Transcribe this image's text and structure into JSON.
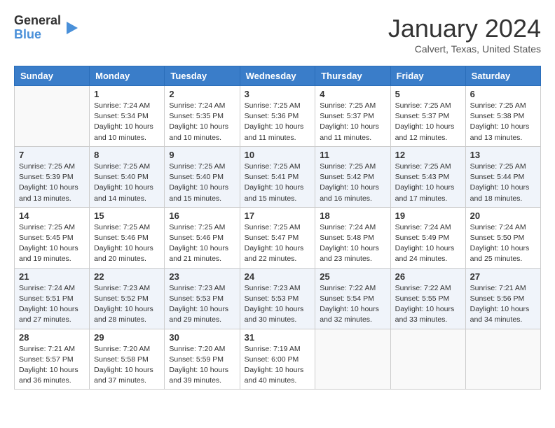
{
  "header": {
    "logo_general": "General",
    "logo_blue": "Blue",
    "month_title": "January 2024",
    "subtitle": "Calvert, Texas, United States"
  },
  "weekdays": [
    "Sunday",
    "Monday",
    "Tuesday",
    "Wednesday",
    "Thursday",
    "Friday",
    "Saturday"
  ],
  "weeks": [
    [
      {
        "day": "",
        "info": ""
      },
      {
        "day": "1",
        "info": "Sunrise: 7:24 AM\nSunset: 5:34 PM\nDaylight: 10 hours\nand 10 minutes."
      },
      {
        "day": "2",
        "info": "Sunrise: 7:24 AM\nSunset: 5:35 PM\nDaylight: 10 hours\nand 10 minutes."
      },
      {
        "day": "3",
        "info": "Sunrise: 7:25 AM\nSunset: 5:36 PM\nDaylight: 10 hours\nand 11 minutes."
      },
      {
        "day": "4",
        "info": "Sunrise: 7:25 AM\nSunset: 5:37 PM\nDaylight: 10 hours\nand 11 minutes."
      },
      {
        "day": "5",
        "info": "Sunrise: 7:25 AM\nSunset: 5:37 PM\nDaylight: 10 hours\nand 12 minutes."
      },
      {
        "day": "6",
        "info": "Sunrise: 7:25 AM\nSunset: 5:38 PM\nDaylight: 10 hours\nand 13 minutes."
      }
    ],
    [
      {
        "day": "7",
        "info": "Sunrise: 7:25 AM\nSunset: 5:39 PM\nDaylight: 10 hours\nand 13 minutes."
      },
      {
        "day": "8",
        "info": "Sunrise: 7:25 AM\nSunset: 5:40 PM\nDaylight: 10 hours\nand 14 minutes."
      },
      {
        "day": "9",
        "info": "Sunrise: 7:25 AM\nSunset: 5:40 PM\nDaylight: 10 hours\nand 15 minutes."
      },
      {
        "day": "10",
        "info": "Sunrise: 7:25 AM\nSunset: 5:41 PM\nDaylight: 10 hours\nand 15 minutes."
      },
      {
        "day": "11",
        "info": "Sunrise: 7:25 AM\nSunset: 5:42 PM\nDaylight: 10 hours\nand 16 minutes."
      },
      {
        "day": "12",
        "info": "Sunrise: 7:25 AM\nSunset: 5:43 PM\nDaylight: 10 hours\nand 17 minutes."
      },
      {
        "day": "13",
        "info": "Sunrise: 7:25 AM\nSunset: 5:44 PM\nDaylight: 10 hours\nand 18 minutes."
      }
    ],
    [
      {
        "day": "14",
        "info": "Sunrise: 7:25 AM\nSunset: 5:45 PM\nDaylight: 10 hours\nand 19 minutes."
      },
      {
        "day": "15",
        "info": "Sunrise: 7:25 AM\nSunset: 5:46 PM\nDaylight: 10 hours\nand 20 minutes."
      },
      {
        "day": "16",
        "info": "Sunrise: 7:25 AM\nSunset: 5:46 PM\nDaylight: 10 hours\nand 21 minutes."
      },
      {
        "day": "17",
        "info": "Sunrise: 7:25 AM\nSunset: 5:47 PM\nDaylight: 10 hours\nand 22 minutes."
      },
      {
        "day": "18",
        "info": "Sunrise: 7:24 AM\nSunset: 5:48 PM\nDaylight: 10 hours\nand 23 minutes."
      },
      {
        "day": "19",
        "info": "Sunrise: 7:24 AM\nSunset: 5:49 PM\nDaylight: 10 hours\nand 24 minutes."
      },
      {
        "day": "20",
        "info": "Sunrise: 7:24 AM\nSunset: 5:50 PM\nDaylight: 10 hours\nand 25 minutes."
      }
    ],
    [
      {
        "day": "21",
        "info": "Sunrise: 7:24 AM\nSunset: 5:51 PM\nDaylight: 10 hours\nand 27 minutes."
      },
      {
        "day": "22",
        "info": "Sunrise: 7:23 AM\nSunset: 5:52 PM\nDaylight: 10 hours\nand 28 minutes."
      },
      {
        "day": "23",
        "info": "Sunrise: 7:23 AM\nSunset: 5:53 PM\nDaylight: 10 hours\nand 29 minutes."
      },
      {
        "day": "24",
        "info": "Sunrise: 7:23 AM\nSunset: 5:53 PM\nDaylight: 10 hours\nand 30 minutes."
      },
      {
        "day": "25",
        "info": "Sunrise: 7:22 AM\nSunset: 5:54 PM\nDaylight: 10 hours\nand 32 minutes."
      },
      {
        "day": "26",
        "info": "Sunrise: 7:22 AM\nSunset: 5:55 PM\nDaylight: 10 hours\nand 33 minutes."
      },
      {
        "day": "27",
        "info": "Sunrise: 7:21 AM\nSunset: 5:56 PM\nDaylight: 10 hours\nand 34 minutes."
      }
    ],
    [
      {
        "day": "28",
        "info": "Sunrise: 7:21 AM\nSunset: 5:57 PM\nDaylight: 10 hours\nand 36 minutes."
      },
      {
        "day": "29",
        "info": "Sunrise: 7:20 AM\nSunset: 5:58 PM\nDaylight: 10 hours\nand 37 minutes."
      },
      {
        "day": "30",
        "info": "Sunrise: 7:20 AM\nSunset: 5:59 PM\nDaylight: 10 hours\nand 39 minutes."
      },
      {
        "day": "31",
        "info": "Sunrise: 7:19 AM\nSunset: 6:00 PM\nDaylight: 10 hours\nand 40 minutes."
      },
      {
        "day": "",
        "info": ""
      },
      {
        "day": "",
        "info": ""
      },
      {
        "day": "",
        "info": ""
      }
    ]
  ]
}
